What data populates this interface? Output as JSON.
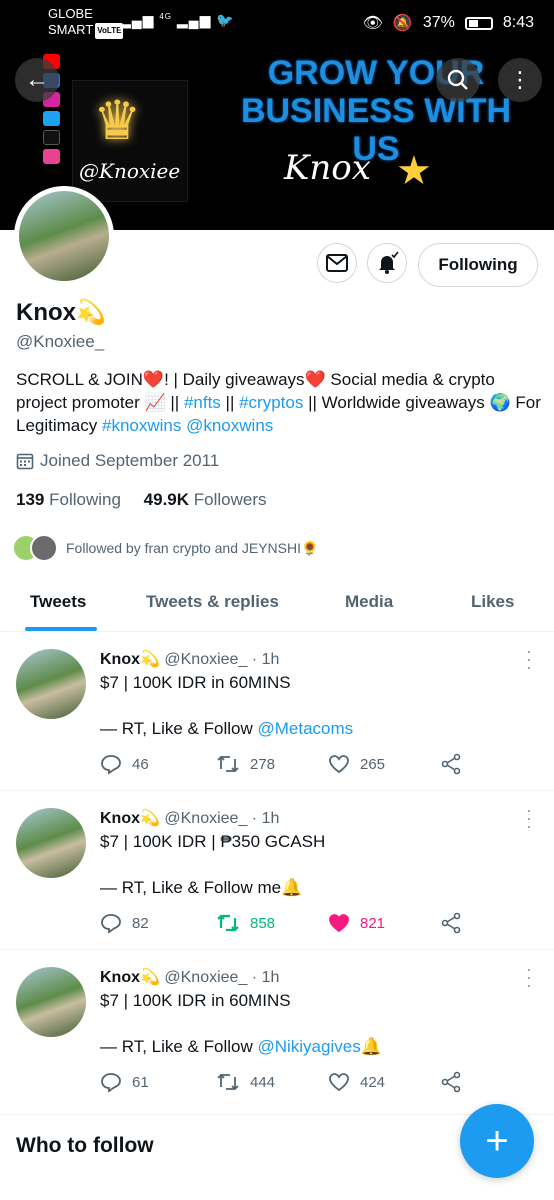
{
  "status_bar": {
    "carrier1": "GLOBE",
    "carrier2": "SMART",
    "volte": "VoLTE",
    "signal": "4G",
    "battery": "37%",
    "time": "8:43"
  },
  "banner": {
    "headline": "GROW YOUR BUSINESS WITH US",
    "logo_text": "@Knoxiee",
    "script_text": "Knox",
    "icons": [
      "back-arrow-icon",
      "search-icon",
      "more-vertical-icon"
    ]
  },
  "profile": {
    "name": "Knox💫",
    "handle": "@Knoxiee_",
    "bio_plain_1": "SCROLL & JOIN❤️! | Daily giveaways❤️ Social media & crypto project promoter 📈 || ",
    "bio_link_1": "#nfts",
    "bio_plain_2": " || ",
    "bio_link_2": "#cryptos",
    "bio_plain_3": " || Worldwide giveaways 🌍 For Legitimacy ",
    "bio_link_3": "#knoxwins",
    "bio_plain_4": " ",
    "bio_link_4": "@knoxwins",
    "joined": "Joined September 2011",
    "following_count": "139",
    "following_label": "Following",
    "followers_count": "49.9K",
    "followers_label": "Followers",
    "followed_by": "Followed by fran crypto and JEYNSHI🌻",
    "follow_button": "Following"
  },
  "tabs": [
    "Tweets",
    "Tweets & replies",
    "Media",
    "Likes"
  ],
  "tweets": [
    {
      "name": "Knox💫",
      "handle": "@Knoxiee_",
      "time": "· 1h",
      "line1": "$7 | 100K IDR in 60MINS",
      "line2_prefix": "— RT, Like & Follow ",
      "line2_link": "@Metacoms",
      "line2_suffix": "",
      "replies": "46",
      "retweets": "278",
      "likes": "265",
      "liked": false,
      "retweeted": false
    },
    {
      "name": "Knox💫",
      "handle": "@Knoxiee_",
      "time": "· 1h",
      "line1": "$7 | 100K IDR | ₱350 GCASH",
      "line2_prefix": "— RT, Like & Follow me🔔",
      "line2_link": "",
      "line2_suffix": "",
      "replies": "82",
      "retweets": "858",
      "likes": "821",
      "liked": true,
      "retweeted": true
    },
    {
      "name": "Knox💫",
      "handle": "@Knoxiee_",
      "time": "· 1h",
      "line1": "$7 | 100K IDR in 60MINS",
      "line2_prefix": "— RT, Like & Follow ",
      "line2_link": "@Nikiyagives",
      "line2_suffix": "🔔",
      "replies": "61",
      "retweets": "444",
      "likes": "424",
      "liked": false,
      "retweeted": false
    }
  ],
  "who_to_follow": "Who to follow",
  "fab_icon": "plus-icon",
  "colors": {
    "accent": "#1d9bf0",
    "like": "#f91880",
    "retweet": "#00ba7c",
    "muted": "#536471"
  }
}
